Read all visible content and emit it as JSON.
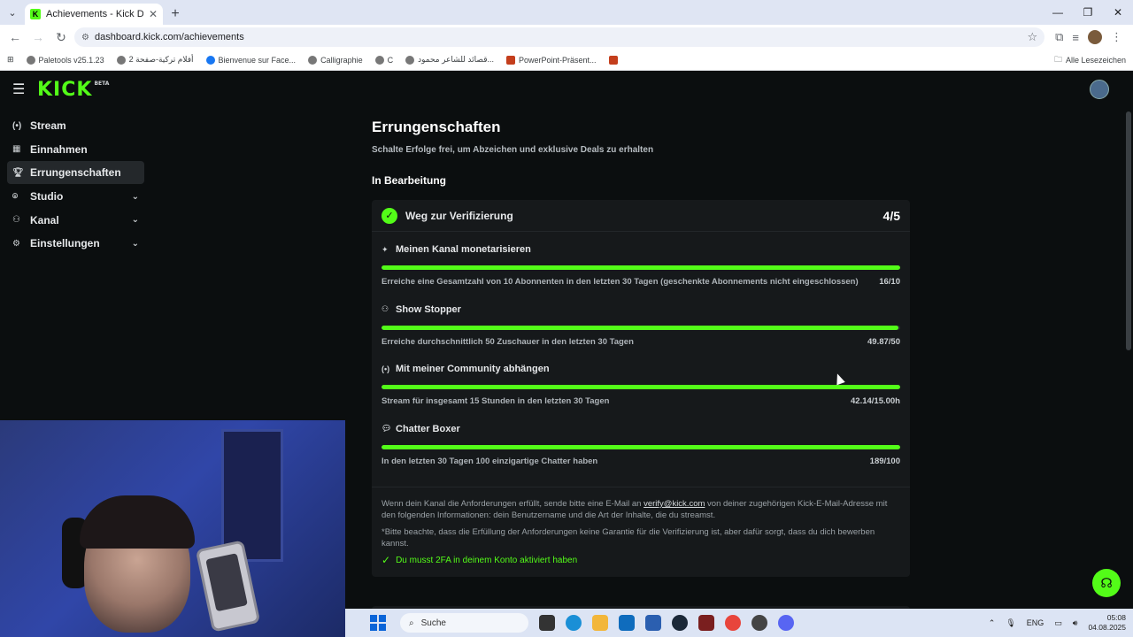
{
  "browser": {
    "tab_title": "Achievements - Kick Dashboard",
    "url": "dashboard.kick.com/achievements",
    "bookmarks": [
      "Paletools v25.1.23",
      "أفلام تركية-صفحة 2",
      "Bienvenue sur Face...",
      "Calligraphie",
      "C",
      "قصائد للشاعر محمود...",
      "PowerPoint-Präsent..."
    ],
    "bookmarks_right": "Alle Lesezeichen"
  },
  "app": {
    "logo": "KICK",
    "logo_badge": "BETA"
  },
  "sidebar": {
    "items": [
      {
        "label": "Stream",
        "icon": "broadcast-icon"
      },
      {
        "label": "Einnahmen",
        "icon": "earnings-icon"
      },
      {
        "label": "Errungenschaften",
        "icon": "trophy-icon"
      },
      {
        "label": "Studio",
        "icon": "studio-icon"
      },
      {
        "label": "Kanal",
        "icon": "channel-icon"
      },
      {
        "label": "Einstellungen",
        "icon": "gear-icon"
      }
    ]
  },
  "main": {
    "title": "Errungenschaften",
    "subtitle": "Schalte Erfolge frei, um Abzeichen und exklusive Deals zu erhalten",
    "section": "In Bearbeitung",
    "card": {
      "title": "Weg zur Verifizierung",
      "count": "4/5",
      "tasks": [
        {
          "title": "Meinen Kanal monetarisieren",
          "desc": "Erreiche eine Gesamtzahl von 10 Abonnenten in den letzten 30 Tagen (geschenkte Abonnements nicht eingeschlossen)",
          "value": "16/10",
          "progress": 100
        },
        {
          "title": "Show Stopper",
          "desc": "Erreiche durchschnittlich 50 Zuschauer in den letzten 30 Tagen",
          "value": "49.87/50",
          "progress": 99.7
        },
        {
          "title": "Mit meiner Community abhängen",
          "desc": "Stream für insgesamt 15 Stunden in den letzten 30 Tagen",
          "value": "42.14/15.00h",
          "progress": 100
        },
        {
          "title": "Chatter Boxer",
          "desc": "In den letzten 30 Tagen 100 einzigartige Chatter haben",
          "value": "189/100",
          "progress": 100
        }
      ],
      "footer_text_1": "Wenn dein Kanal die Anforderungen erfüllt, sende bitte eine E-Mail an",
      "footer_email": "verify@kick.com",
      "footer_text_2": "von deiner zugehörigen Kick-E-Mail-Adresse mit den folgenden Informationen: dein Benutzername und die Art der Inhalte, die du streamst.",
      "footer_note": "*Bitte beachte, dass die Erfüllung der Anforderungen keine Garantie für die Verifizierung ist, aber dafür sorgt, dass du dich bewerben kannst.",
      "twofa": "Du musst 2FA in deinem Konto aktiviert haben"
    }
  },
  "taskbar": {
    "search": "Suche",
    "lang": "ENG",
    "time": "05:08",
    "date": "04.08.2025"
  },
  "colors": {
    "accent": "#53fc18",
    "bg": "#0b0e0f",
    "card": "#16191b"
  }
}
